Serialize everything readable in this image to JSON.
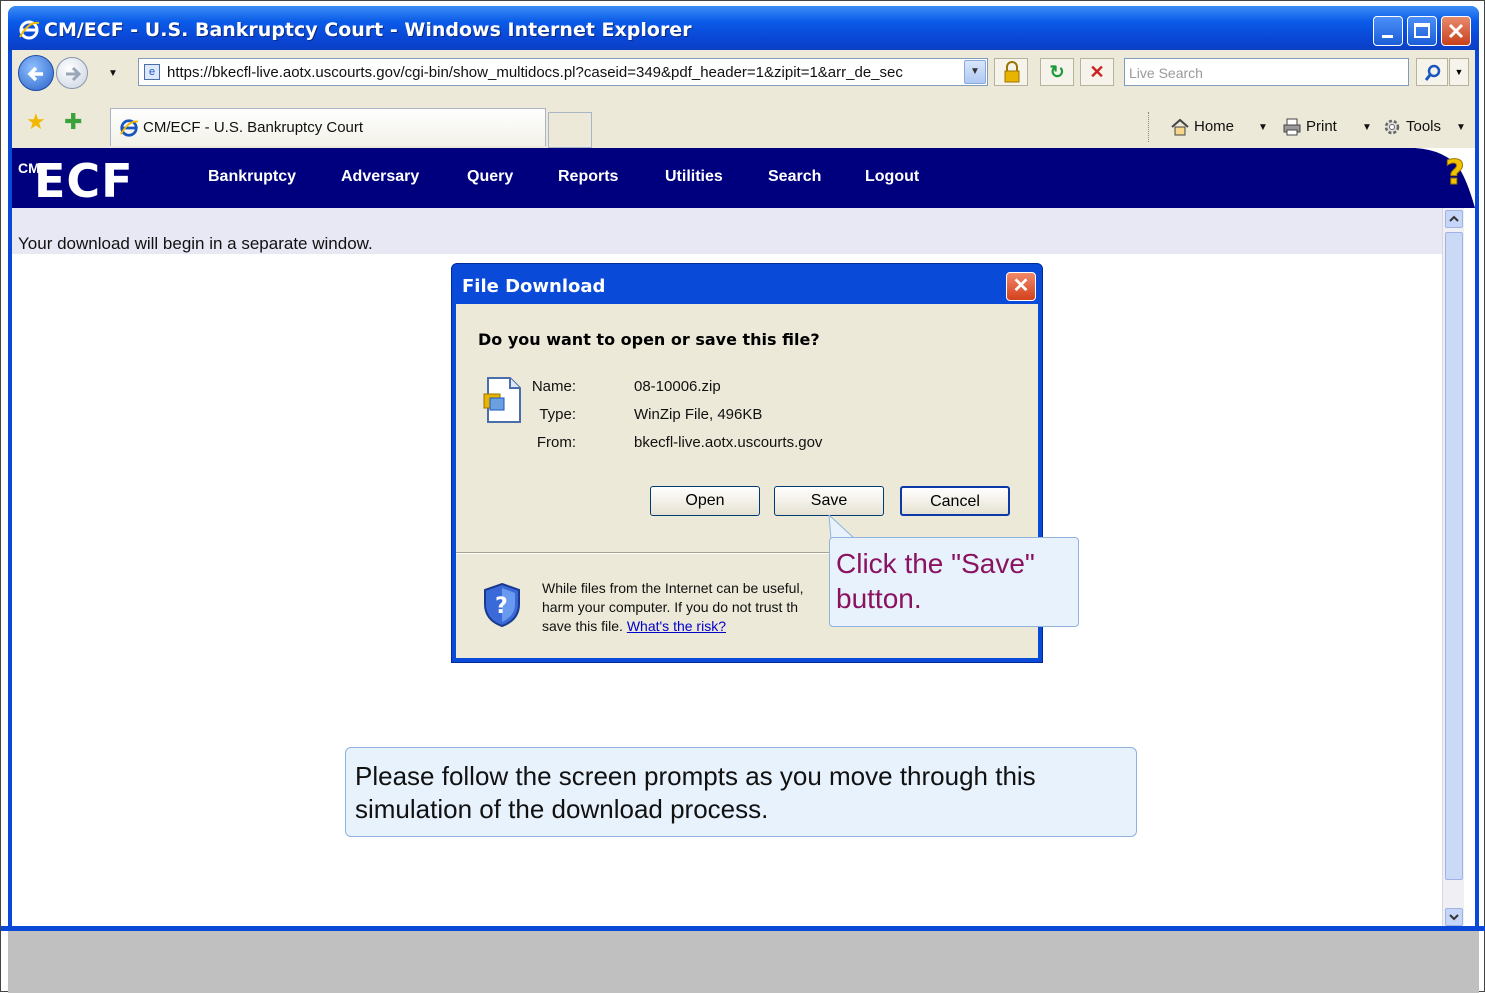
{
  "window": {
    "title": "CM/ECF - U.S. Bankruptcy Court - Windows Internet Explorer"
  },
  "toolbar": {
    "url": "https://bkecfl-live.aotx.uscourts.gov/cgi-bin/show_multidocs.pl?caseid=349&pdf_header=1&zipit=1&arr_de_sec",
    "search_placeholder": "Live Search",
    "tab_title": "CM/ECF - U.S. Bankruptcy Court",
    "home": "Home",
    "print": "Print",
    "tools": "Tools"
  },
  "ecf": {
    "logo": "ECF",
    "logo_cm": "CM",
    "menu": [
      "Bankruptcy",
      "Adversary",
      "Query",
      "Reports",
      "Utilities",
      "Search",
      "Logout"
    ]
  },
  "page": {
    "message": "Your download will begin in a separate window."
  },
  "dialog": {
    "title": "File Download",
    "question": "Do you want to open or save this file?",
    "name_label": "Name:",
    "name_value": "08-10006.zip",
    "type_label": "Type:",
    "type_value": "WinZip File, 496KB",
    "from_label": "From:",
    "from_value": "bkecfl-live.aotx.uscourts.gov",
    "open": "Open",
    "save": "Save",
    "cancel": "Cancel",
    "warning_line1": "While files from the Internet can be useful,",
    "warning_line2": "harm your computer. If you do not trust th",
    "warning_line3": "save this file.",
    "risk_link": "What's the risk?"
  },
  "callout": {
    "text": "Click the \"Save\" button."
  },
  "tip": {
    "text": "Please follow the screen prompts as you move through this simulation of the download process."
  },
  "icons": [
    "ie-icon",
    "back-icon",
    "forward-icon",
    "lock-icon",
    "refresh-icon",
    "stop-icon",
    "search-icon",
    "favorites-icon",
    "add-favorites-icon",
    "home-icon",
    "print-icon",
    "tools-icon",
    "help-icon",
    "file-icon",
    "shield-icon"
  ]
}
